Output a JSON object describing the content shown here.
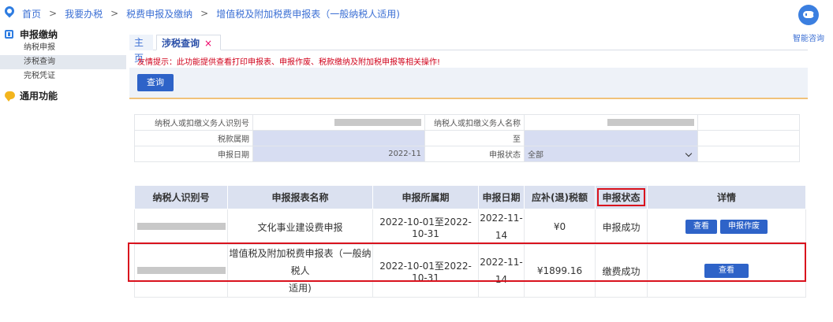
{
  "breadcrumb": {
    "items": [
      "首页",
      "我要办税",
      "税费申报及缴纳",
      "增值税及附加税费申报表（一般纳税人适用)"
    ]
  },
  "assistant": {
    "label": "智能咨询"
  },
  "sidebar": {
    "group1": "申报缴纳",
    "items": [
      "纳税申报",
      "涉税查询",
      "完税凭证"
    ],
    "group2": "通用功能"
  },
  "tabs": {
    "home": "主页",
    "query": "涉税查询",
    "close": "×"
  },
  "tip": "友情提示：此功能提供查看打印申报表、申报作废、税款缴纳及附加税申报等相关操作!",
  "toolbar": {
    "query_button": "查询"
  },
  "form": {
    "taxpayer_id_label": "纳税人或扣缴义务人识别号",
    "taxpayer_name_label": "纳税人或扣缴义务人名称",
    "period_label": "税款属期",
    "to_label": "至",
    "date_label": "申报日期",
    "date_value": "2022-11",
    "status_label": "申报状态",
    "status_value": "全部"
  },
  "result": {
    "headers": [
      "纳税人识别号",
      "申报报表名称",
      "申报所属期",
      "申报日期",
      "应补(退)税额",
      "申报状态",
      "详情"
    ],
    "rows": [
      {
        "name": "文化事业建设费申报",
        "period": "2022-10-01至2022-10-31",
        "date_a": "2022-11-",
        "date_b": "14",
        "amount": "¥0",
        "status": "申报成功",
        "btn_view": "查看",
        "btn_void": "申报作废"
      },
      {
        "name_a": "增值税及附加税费申报表（一般纳税人",
        "name_b": "适用)",
        "period": "2022-10-01至2022-10-31",
        "date_a": "2022-11-",
        "date_b": "14",
        "amount": "¥1899.16",
        "status": "缴费成功",
        "btn_view": "查看"
      }
    ]
  },
  "colors": {
    "accent": "#2e63c8",
    "highlight": "#d9121d",
    "header_bg": "#dbe1f0",
    "tip": "#d0021b"
  }
}
